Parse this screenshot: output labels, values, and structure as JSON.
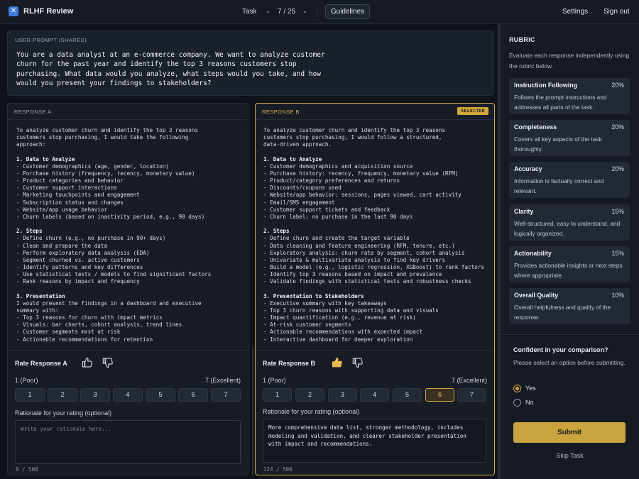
{
  "header": {
    "logo_glyph": "✕",
    "app_title": "RLHF Review",
    "task_label": "Task",
    "task_counter": "7 / 25",
    "guidelines": "Guidelines",
    "settings": "Settings",
    "sign_out": "Sign out"
  },
  "prompt": {
    "label": "USER PROMPT (SHARED)",
    "text": "You are a data analyst at an e-commerce company. We want to analyze customer\nchurn for the past year and identify the top 3 reasons customers stop\npurchasing. What data would you analyze, what steps would you take, and how\nwould you present your findings to stakeholders?"
  },
  "response_a": {
    "title": "RESPONSE A",
    "intro": "To analyze customer churn and identify the top 3 reasons\ncustomers stop purchasing, I would take the following\napproach:",
    "s1_title": "1. Data to Analyze",
    "s1_body": "- Customer demographics (age, gender, location)\n- Purchase history (frequency, recency, monetary value)\n- Product categories and behavior\n- Customer support interactions\n- Marketing touchpoints and engagement\n- Subscription status and changes\n- Website/app usage behavior\n- Churn labels (based on inactivity period, e.g., 90 days)",
    "s2_title": "2. Steps",
    "s2_body": "- Define churn (e.g., no purchase in 90+ days)\n- Clean and prepare the data\n- Perform exploratory data analysis (EDA)\n- Segment churned vs. active customers\n- Identify patterns and key differences\n- Use statistical tests / models to find significant factors\n- Rank reasons by impact and frequency",
    "s3_title": "3. Presentation",
    "s3_body": "I would present the findings in a dashboard and executive\nsummary with:\n- Top 3 reasons for churn with impact metrics\n- Visuals: bar charts, cohort analysis, trend lines\n- Customer segments most at risk\n- Actionable recommendations for retention",
    "rate_label": "Rate Response A",
    "scale_low": "1 (Poor)",
    "scale_high": "7 (Excellent)",
    "scores": [
      "1",
      "2",
      "3",
      "4",
      "5",
      "6",
      "7"
    ],
    "rationale_label": "Rationale for your rating (optional)",
    "rationale_placeholder": "Write your rationale here...",
    "char_count": "0 / 500"
  },
  "response_b": {
    "title": "RESPONSE B",
    "badge": "SELECTED",
    "intro": "To analyze customer churn and identify the top 3 reasons\ncustomers stop purchasing, I would follow a structured,\ndata-driven approach.",
    "s1_title": "1. Data to Analyze",
    "s1_body": "- Customer demographics and acquisition source\n- Purchase history: recency, frequency, monetary value (RFM)\n- Product/category preferences and returns\n- Discounts/coupons used\n- Website/app behavior: sessions, pages viewed, cart activity\n- Email/SMS engagement\n- Customer support tickets and feedback\n- Churn label: no purchase in the last 90 days",
    "s2_title": "2. Steps",
    "s2_body": "- Define churn and create the target variable\n- Data cleaning and feature engineering (RFM, tenure, etc.)\n- Exploratory analysis: churn rate by segment, cohort analysis\n- Univariate & multivariate analysis to find key drivers\n- Build a model (e.g., logistic regression, XGBoost) to rank factors\n- Identify top 3 reasons based on impact and prevalence\n- Validate findings with statistical tests and robustness checks",
    "s3_title": "3. Presentation to Stakeholders",
    "s3_body": "- Executive summary with key takeaways\n- Top 3 churn reasons with supporting data and visuals\n- Impact quantification (e.g., revenue at risk)\n- At-risk customer segments\n- Actionable recommendations with expected impact\n- Interactive dashboard for deeper exploration",
    "rate_label": "Rate Response B",
    "scale_low": "1 (Poor)",
    "scale_high": "7 (Excellent)",
    "scores": [
      "1",
      "2",
      "3",
      "4",
      "5",
      "6",
      "7"
    ],
    "selected_score": "6",
    "rationale_label": "Rationale for your rating (optional)",
    "rationale_value": "More comprehensive data list, stronger methodology, includes\nmodeling and validation, and clearer stakeholder presentation\nwith impact and recommendations.",
    "char_count": "124 / 500"
  },
  "rubric": {
    "title": "RUBRIC",
    "description": "Evaluate each response independently using the rubric below.",
    "criteria": [
      {
        "name": "Instruction Following",
        "weight": "20%",
        "desc": "Follows the prompt instructions and addresses all parts of the task."
      },
      {
        "name": "Completeness",
        "weight": "20%",
        "desc": "Covers all key aspects of the task thoroughly."
      },
      {
        "name": "Accuracy",
        "weight": "20%",
        "desc": "Information is factually correct and relevant."
      },
      {
        "name": "Clarity",
        "weight": "15%",
        "desc": "Well-structured, easy to understand, and logically organized."
      },
      {
        "name": "Actionability",
        "weight": "15%",
        "desc": "Provides actionable insights or next steps where appropriate."
      },
      {
        "name": "Overall Quality",
        "weight": "10%",
        "desc": "Overall helpfulness and quality of the response."
      }
    ]
  },
  "confidence": {
    "title": "Confident in your comparison?",
    "description": "Please select an option before submitting.",
    "options": [
      "Yes",
      "No"
    ],
    "selected": "Yes",
    "submit": "Submit",
    "skip": "Skip Task"
  },
  "colors": {
    "accent": "#d4a73a",
    "background": "#0f131a",
    "panel": "#181d25"
  },
  "icons": {
    "logo": "logo-icon",
    "chevron": "chevron-down-icon",
    "thumbs_up": "thumbs-up-icon",
    "thumbs_down": "thumbs-down-icon"
  }
}
